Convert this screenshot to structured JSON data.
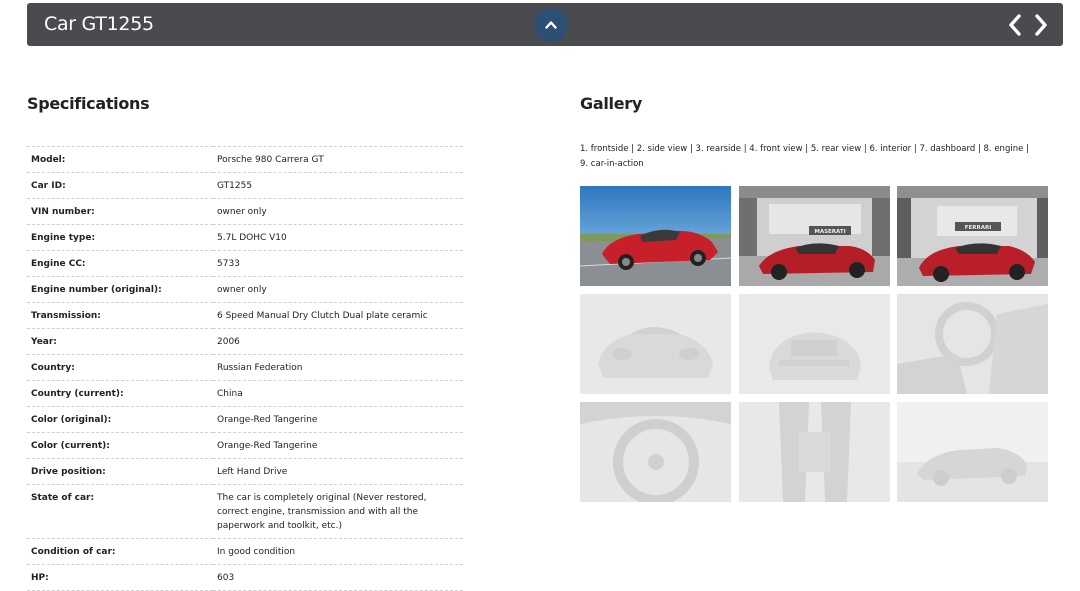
{
  "header": {
    "title": "Car GT1255"
  },
  "specifications": {
    "title": "Specifications",
    "rows": [
      {
        "label": "Model:",
        "value": "Porsche 980 Carrera GT"
      },
      {
        "label": "Car ID:",
        "value": "GT1255"
      },
      {
        "label": "VIN number:",
        "value": "owner only"
      },
      {
        "label": "Engine type:",
        "value": "5.7L DOHC V10"
      },
      {
        "label": "Engine CC:",
        "value": "5733"
      },
      {
        "label": "Engine number (original):",
        "value": "owner only"
      },
      {
        "label": "Transmission:",
        "value": "6 Speed Manual Dry Clutch Dual plate ceramic"
      },
      {
        "label": "Year:",
        "value": "2006"
      },
      {
        "label": "Country:",
        "value": "Russian Federation"
      },
      {
        "label": "Country (current):",
        "value": "China"
      },
      {
        "label": "Color (original):",
        "value": "Orange-Red Tangerine"
      },
      {
        "label": "Color (current):",
        "value": "Orange-Red Tangerine"
      },
      {
        "label": "Drive position:",
        "value": "Left Hand Drive"
      },
      {
        "label": "State of car:",
        "value": "The car is completely original (Never restored, correct engine, transmission and with all the paperwork and toolkit, etc.)"
      },
      {
        "label": "Condition of car:",
        "value": "In good condition"
      },
      {
        "label": "HP:",
        "value": "603"
      }
    ]
  },
  "gallery": {
    "title": "Gallery",
    "links": [
      "1. frontside",
      "2. side view",
      "3. rearside",
      "4. front view",
      "5. rear view",
      "6. interior",
      "7. dashboard",
      "8. engine",
      "9. car-in-action"
    ],
    "separator": "|",
    "thumbnails": [
      {
        "caption": "frontside",
        "sign": ""
      },
      {
        "caption": "side view",
        "sign": "MASERATI"
      },
      {
        "caption": "rearside",
        "sign": "FERRARI"
      },
      {
        "caption": "front view",
        "sign": ""
      },
      {
        "caption": "rear view",
        "sign": ""
      },
      {
        "caption": "interior",
        "sign": ""
      },
      {
        "caption": "dashboard",
        "sign": ""
      },
      {
        "caption": "engine",
        "sign": ""
      },
      {
        "caption": "car-in-action",
        "sign": ""
      }
    ]
  },
  "colors": {
    "topbar": "#4a4b4f",
    "toggle": "#2d4f75",
    "car": "#c8202a",
    "sky": "#3a85c8"
  },
  "icons": {
    "toggle": "chevron-up-icon",
    "prev": "chevron-left-icon",
    "next": "chevron-right-icon"
  }
}
